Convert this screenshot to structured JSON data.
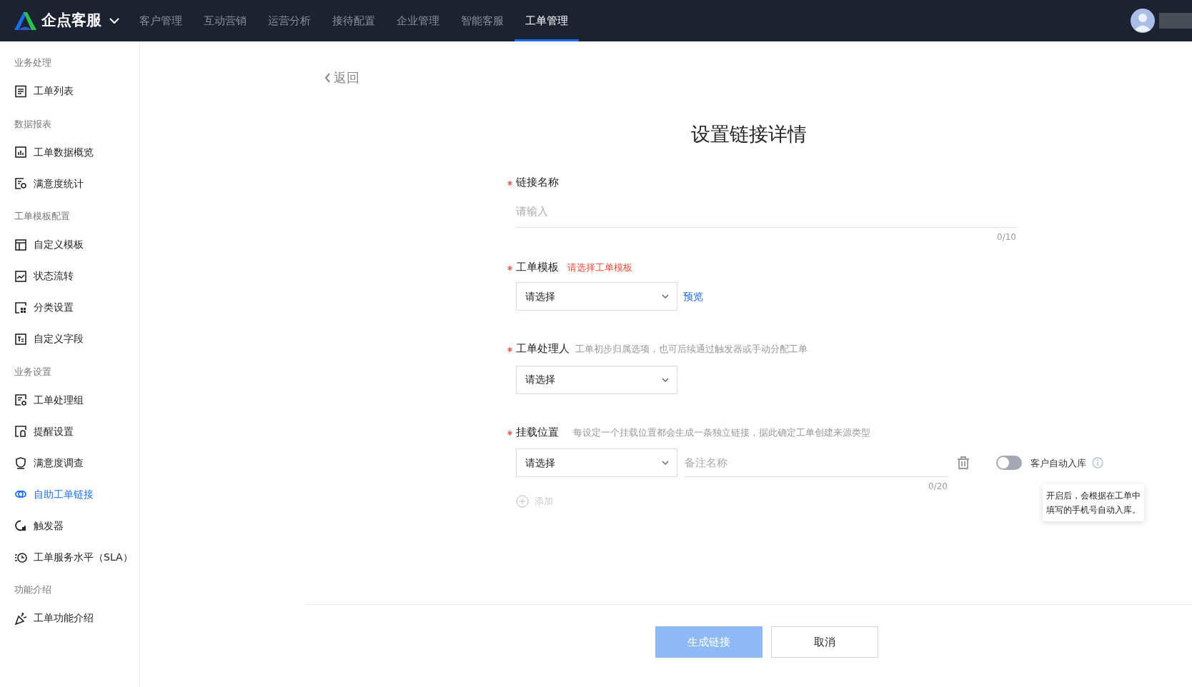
{
  "topbar": {
    "brand": "企点客服",
    "nav": [
      {
        "label": "客户管理",
        "selected": false
      },
      {
        "label": "互动营销",
        "selected": false
      },
      {
        "label": "运营分析",
        "selected": false
      },
      {
        "label": "接待配置",
        "selected": false
      },
      {
        "label": "企业管理",
        "selected": false
      },
      {
        "label": "智能客服",
        "selected": false
      },
      {
        "label": "工单管理",
        "selected": true
      }
    ]
  },
  "sidebar": {
    "groups": [
      {
        "title": "业务处理",
        "items": [
          {
            "label": "工单列表",
            "selected": false
          }
        ]
      },
      {
        "title": "数据报表",
        "items": [
          {
            "label": "工单数据概览",
            "selected": false
          },
          {
            "label": "满意度统计",
            "selected": false
          }
        ]
      },
      {
        "title": "工单模板配置",
        "items": [
          {
            "label": "自定义模板",
            "selected": false
          },
          {
            "label": "状态流转",
            "selected": false
          },
          {
            "label": "分类设置",
            "selected": false
          },
          {
            "label": "自定义字段",
            "selected": false
          }
        ]
      },
      {
        "title": "业务设置",
        "items": [
          {
            "label": "工单处理组",
            "selected": false
          },
          {
            "label": "提醒设置",
            "selected": false
          },
          {
            "label": "满意度调查",
            "selected": false
          },
          {
            "label": "自助工单链接",
            "selected": true
          },
          {
            "label": "触发器",
            "selected": false
          },
          {
            "label": "工单服务水平（SLA）",
            "selected": false
          }
        ]
      },
      {
        "title": "功能介绍",
        "items": [
          {
            "label": "工单功能介绍",
            "selected": false
          }
        ]
      }
    ]
  },
  "back": "返回",
  "title": "设置链接详情",
  "link_name": {
    "required": true,
    "label": "链接名称",
    "placeholder": "请输入",
    "counter": "0/10"
  },
  "template": {
    "required": true,
    "label": "工单模板",
    "error": "请选择工单模板",
    "select": {
      "placeholder": "请选择"
    },
    "preview": "预览"
  },
  "handler": {
    "required": true,
    "label": "工单处理人",
    "hint": "工单初步归属选项，也可后续通过触发器或手动分配工单",
    "select": {
      "placeholder": "请选择"
    }
  },
  "mount": {
    "required": true,
    "label": "挂载位置",
    "hint": "每设定一个挂载位置都会生成一条独立链接，据此确定工单创建来源类型",
    "select": {
      "placeholder": "请选择"
    },
    "note": {
      "placeholder": "备注名称",
      "counter": "0/20"
    },
    "add": "添加",
    "toggle": {
      "label": "客户自动入库",
      "on": false
    },
    "tooltip": "开启后，会根据在工单中填写的手机号自动入库。"
  },
  "buttons": [
    {
      "label": "生成链接",
      "kind": "primary",
      "disabled": true
    },
    {
      "label": "取消",
      "kind": "secondary",
      "disabled": false
    }
  ]
}
